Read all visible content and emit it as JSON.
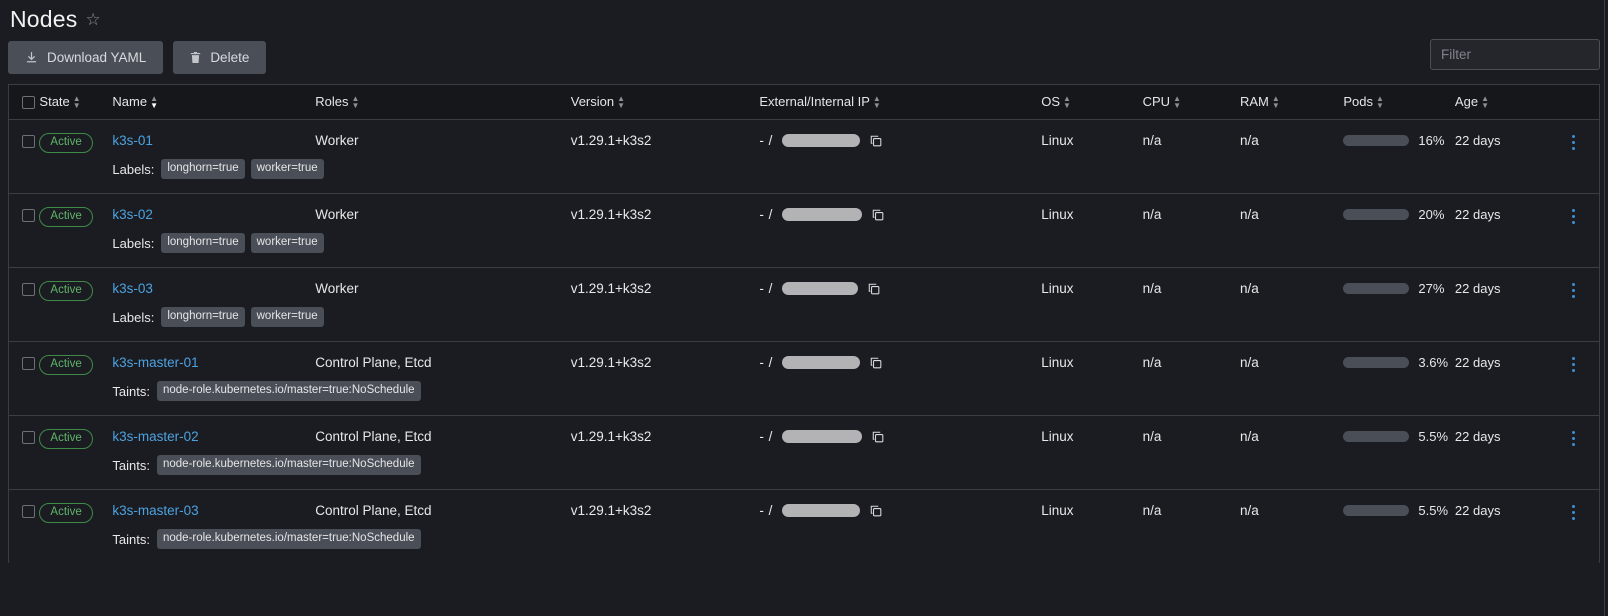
{
  "header": {
    "title": "Nodes",
    "star_icon": "star-outline-icon"
  },
  "toolbar": {
    "download_yaml_label": "Download YAML",
    "download_icon": "download-icon",
    "delete_label": "Delete",
    "delete_icon": "trash-icon",
    "filter_placeholder": "Filter",
    "filter_value": ""
  },
  "table": {
    "columns": [
      {
        "key": "state",
        "label": "State",
        "sorted": false
      },
      {
        "key": "name",
        "label": "Name",
        "sorted": true
      },
      {
        "key": "roles",
        "label": "Roles",
        "sorted": false
      },
      {
        "key": "version",
        "label": "Version",
        "sorted": false
      },
      {
        "key": "ip",
        "label": "External/Internal IP",
        "sorted": false
      },
      {
        "key": "os",
        "label": "OS",
        "sorted": false
      },
      {
        "key": "cpu",
        "label": "CPU",
        "sorted": false
      },
      {
        "key": "ram",
        "label": "RAM",
        "sorted": false
      },
      {
        "key": "pods",
        "label": "Pods",
        "sorted": false
      },
      {
        "key": "age",
        "label": "Age",
        "sorted": false
      }
    ],
    "rows": [
      {
        "state": "Active",
        "name": "k3s-01",
        "roles": "Worker",
        "version": "v1.29.1+k3s2",
        "ip_prefix": "- /",
        "ip_redacted": true,
        "ip_redacted_width": 78,
        "os": "Linux",
        "cpu": "n/a",
        "ram": "n/a",
        "pods_percent": "16%",
        "pods_value": 16,
        "age": "22 days",
        "meta_label": "Labels:",
        "meta_chips": [
          "longhorn=true",
          "worker=true"
        ]
      },
      {
        "state": "Active",
        "name": "k3s-02",
        "roles": "Worker",
        "version": "v1.29.1+k3s2",
        "ip_prefix": "- /",
        "ip_redacted": true,
        "ip_redacted_width": 80,
        "os": "Linux",
        "cpu": "n/a",
        "ram": "n/a",
        "pods_percent": "20%",
        "pods_value": 20,
        "age": "22 days",
        "meta_label": "Labels:",
        "meta_chips": [
          "longhorn=true",
          "worker=true"
        ]
      },
      {
        "state": "Active",
        "name": "k3s-03",
        "roles": "Worker",
        "version": "v1.29.1+k3s2",
        "ip_prefix": "- /",
        "ip_redacted": true,
        "ip_redacted_width": 76,
        "os": "Linux",
        "cpu": "n/a",
        "ram": "n/a",
        "pods_percent": "27%",
        "pods_value": 27,
        "age": "22 days",
        "meta_label": "Labels:",
        "meta_chips": [
          "longhorn=true",
          "worker=true"
        ]
      },
      {
        "state": "Active",
        "name": "k3s-master-01",
        "roles": "Control Plane, Etcd",
        "version": "v1.29.1+k3s2",
        "ip_prefix": "- /",
        "ip_redacted": true,
        "ip_redacted_width": 78,
        "os": "Linux",
        "cpu": "n/a",
        "ram": "n/a",
        "pods_percent": "3.6%",
        "pods_value": 3.6,
        "age": "22 days",
        "meta_label": "Taints:",
        "meta_chips": [
          "node-role.kubernetes.io/master=true:NoSchedule"
        ]
      },
      {
        "state": "Active",
        "name": "k3s-master-02",
        "roles": "Control Plane, Etcd",
        "version": "v1.29.1+k3s2",
        "ip_prefix": "- /",
        "ip_redacted": true,
        "ip_redacted_width": 80,
        "os": "Linux",
        "cpu": "n/a",
        "ram": "n/a",
        "pods_percent": "5.5%",
        "pods_value": 5.5,
        "age": "22 days",
        "meta_label": "Taints:",
        "meta_chips": [
          "node-role.kubernetes.io/master=true:NoSchedule"
        ]
      },
      {
        "state": "Active",
        "name": "k3s-master-03",
        "roles": "Control Plane, Etcd",
        "version": "v1.29.1+k3s2",
        "ip_prefix": "- /",
        "ip_redacted": true,
        "ip_redacted_width": 78,
        "os": "Linux",
        "cpu": "n/a",
        "ram": "n/a",
        "pods_percent": "5.5%",
        "pods_value": 5.5,
        "age": "22 days",
        "meta_label": "Taints:",
        "meta_chips": [
          "node-role.kubernetes.io/master=true:NoSchedule"
        ]
      }
    ],
    "row_menu_icon": "kebab-menu-icon",
    "copy_icon": "copy-icon"
  },
  "colors": {
    "background": "#1b1c21",
    "accent_link": "#4ca2e0",
    "progress_fill": "#3397df",
    "status_active": "#5fb56a",
    "chip_bg": "#4a4e57",
    "border": "#3a3d44"
  }
}
